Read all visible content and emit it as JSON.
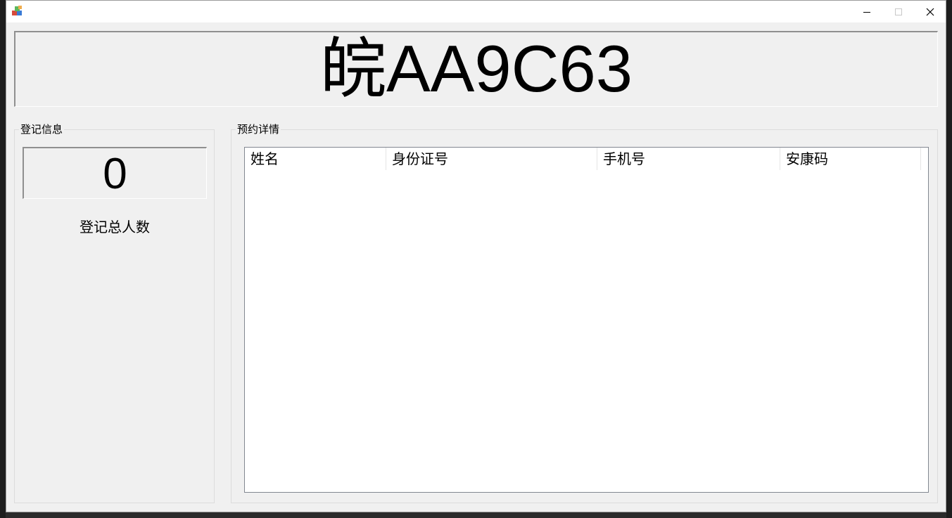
{
  "window": {
    "title": "",
    "controls": {
      "minimize": "minimize-icon",
      "maximize": "maximize-icon",
      "close": "close-icon"
    }
  },
  "plate": {
    "number": "皖AA9C63"
  },
  "registration": {
    "group_title": "登记信息",
    "count": "0",
    "count_label": "登记总人数"
  },
  "reservations": {
    "group_title": "预约详情",
    "columns": [
      "姓名",
      "身份证号",
      "手机号",
      "安康码"
    ],
    "rows": []
  },
  "colors": {
    "window_bg": "#f0f0f0",
    "titlebar_bg": "#ffffff",
    "table_bg": "#ffffff",
    "text": "#000000"
  }
}
